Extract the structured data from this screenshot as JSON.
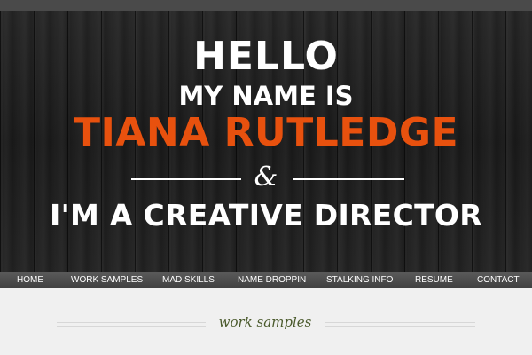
{
  "hero": {
    "greeting": "HELLO",
    "intro": "MY NAME IS",
    "name": "TIANA RUTLEDGE",
    "ampersand": "&",
    "role": "I'M A CREATIVE DIRECTOR"
  },
  "nav": {
    "items": [
      {
        "label": "HOME"
      },
      {
        "label": "WORK SAMPLES"
      },
      {
        "label": "MAD SKILLS"
      },
      {
        "label": "NAME DROPPIN"
      },
      {
        "label": "STALKING INFO"
      },
      {
        "label": "RESUME"
      },
      {
        "label": "CONTACT"
      }
    ]
  },
  "section": {
    "title": "work samples"
  },
  "colors": {
    "accent": "#e8510e",
    "hero_background": "#1c1c1c",
    "nav_background": "#4a4a4a",
    "section_title": "#4a5a2c",
    "page_background": "#f0f0f0"
  }
}
